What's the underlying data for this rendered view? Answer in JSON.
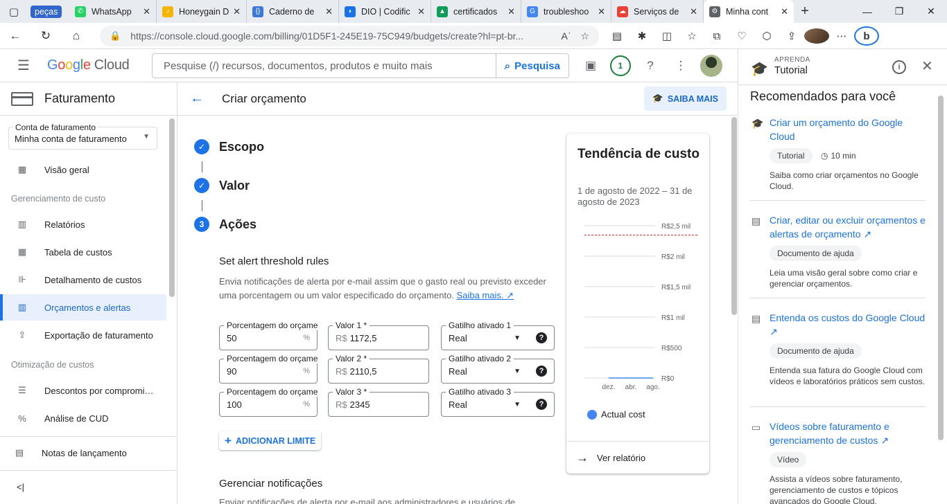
{
  "browser": {
    "tabs": [
      {
        "label": "peças",
        "kind": "group"
      },
      {
        "label": "WhatsApp",
        "color": "#25d366",
        "glyph": "✆"
      },
      {
        "label": "Honeygain D",
        "color": "#f5b400",
        "glyph": "♪"
      },
      {
        "label": "Caderno de",
        "color": "#3c78d8",
        "glyph": "{}"
      },
      {
        "label": "DIO | Codific",
        "color": "#1a73e8",
        "glyph": "◗"
      },
      {
        "label": "certificados",
        "color": "#0f9d58",
        "glyph": "▲"
      },
      {
        "label": "troubleshoo",
        "color": "#4285f4",
        "glyph": "G"
      },
      {
        "label": "Serviços de",
        "color": "#ea4335",
        "glyph": "☁"
      },
      {
        "label": "Minha cont",
        "color": "#5f6368",
        "glyph": "⚙",
        "active": true
      }
    ],
    "url": "https://console.cloud.google.com/billing/01D5F1-245E19-75C949/budgets/create?hl=pt-br...",
    "reader_label": "Aʾ",
    "notif_count": "1"
  },
  "header": {
    "logo_google": "Google",
    "logo_cloud": "Cloud",
    "search_placeholder": "Pesquise (/) recursos, documentos, produtos e muito mais",
    "search_button": "Pesquisa",
    "notification_badge": "1"
  },
  "leftnav": {
    "title": "Faturamento",
    "account_label": "Conta de faturamento",
    "account_value": "Minha conta de faturamento",
    "items": [
      {
        "label": "Visão geral",
        "icon": "dashboard-icon"
      },
      {
        "label": "Relatórios",
        "icon": "bar-chart-icon"
      },
      {
        "label": "Tabela de custos",
        "icon": "table-icon"
      },
      {
        "label": "Detalhamento de custos",
        "icon": "breakdown-icon"
      },
      {
        "label": "Orçamentos e alertas",
        "icon": "budget-icon",
        "active": true
      },
      {
        "label": "Exportação de faturamento",
        "icon": "export-icon"
      },
      {
        "label": "Descontos por compromi…",
        "icon": "list-icon"
      },
      {
        "label": "Análise de CUD",
        "icon": "percent-icon"
      },
      {
        "label": "Notas de lançamento",
        "icon": "notes-icon"
      }
    ],
    "section_cost": "Gerenciamento de custo",
    "section_opt": "Otimização de custos",
    "collapse": "<|"
  },
  "main": {
    "title": "Criar orçamento",
    "learn_more": "SAIBA MAIS",
    "steps": [
      {
        "label": "Escopo",
        "state": "done"
      },
      {
        "label": "Valor",
        "state": "done"
      },
      {
        "label": "Ações",
        "state": "current",
        "number": "3"
      }
    ],
    "section_title": "Set alert threshold rules",
    "section_desc": "Envia notificações de alerta por e-mail assim que o gasto real ou previsto exceder uma porcentagem ou um valor especificado do orçamento.",
    "section_link": "Saiba mais.",
    "rules": [
      {
        "pct_label": "Porcentagem do orçamento",
        "pct": "50",
        "val_label": "Valor 1 *",
        "val": "1172,5",
        "trig_label": "Gatilho ativado 1",
        "trig": "Real"
      },
      {
        "pct_label": "Porcentagem do orçamento",
        "pct": "90",
        "val_label": "Valor 2 *",
        "val": "2110,5",
        "trig_label": "Gatilho ativado 2",
        "trig": "Real"
      },
      {
        "pct_label": "Porcentagem do orçamento",
        "pct": "100",
        "val_label": "Valor 3 *",
        "val": "2345",
        "trig_label": "Gatilho ativado 3",
        "trig": "Real"
      }
    ],
    "pct_suffix": "%",
    "currency": "R$",
    "add_button": "ADICIONAR LIMITE",
    "notif_title": "Gerenciar notificações",
    "notif_desc": "Enviar notificações de alerta por e-mail aos administradores e usuários de"
  },
  "trend": {
    "title": "Tendência de custo",
    "dates": "1 de agosto de 2022 – 31 de agosto de 2023",
    "legend": "Actual cost",
    "footer": "Ver relatório",
    "colors": {
      "actual": "#4285f4",
      "budget": "#c5221f"
    }
  },
  "chart_data": {
    "type": "line",
    "x": [
      "dez.",
      "abr.",
      "ago."
    ],
    "y_ticks": [
      "R$0",
      "R$500",
      "R$1 mil",
      "R$1,5 mil",
      "R$2 mil",
      "R$2,5 mil"
    ],
    "y_tick_values": [
      0,
      500,
      1000,
      1500,
      2000,
      2500
    ],
    "ylim": [
      0,
      2500
    ],
    "budget_line": 2345,
    "series": [
      {
        "name": "Actual cost",
        "values": [
          0,
          0,
          0
        ]
      }
    ]
  },
  "tutorial": {
    "eyebrow": "APRENDA",
    "title": "Tutorial",
    "heading": "Recomendados para você",
    "items": [
      {
        "title": "Criar um orçamento do Google Cloud",
        "chip": "Tutorial",
        "duration": "10 min",
        "desc": "Saiba como criar orçamentos no Google Cloud.",
        "icon": "tutorial-icon"
      },
      {
        "title": "Criar, editar ou excluir orçamentos e alertas de orçamento",
        "chip": "Documento de ajuda",
        "desc": "Leia uma visão geral sobre como criar e gerenciar orçamentos.",
        "icon": "document-icon"
      },
      {
        "title": "Entenda os custos do Google Cloud",
        "chip": "Documento de ajuda",
        "desc": "Entenda sua fatura do Google Cloud com vídeos e laboratórios práticos sem custos.",
        "icon": "document-icon"
      },
      {
        "title": "Vídeos sobre faturamento e gerenciamento de custos",
        "chip": "Vídeo",
        "desc": "Assista a vídeos sobre faturamento, gerenciamento de custos e tópicos avançados do Google Cloud.",
        "icon": "video-icon"
      }
    ]
  }
}
